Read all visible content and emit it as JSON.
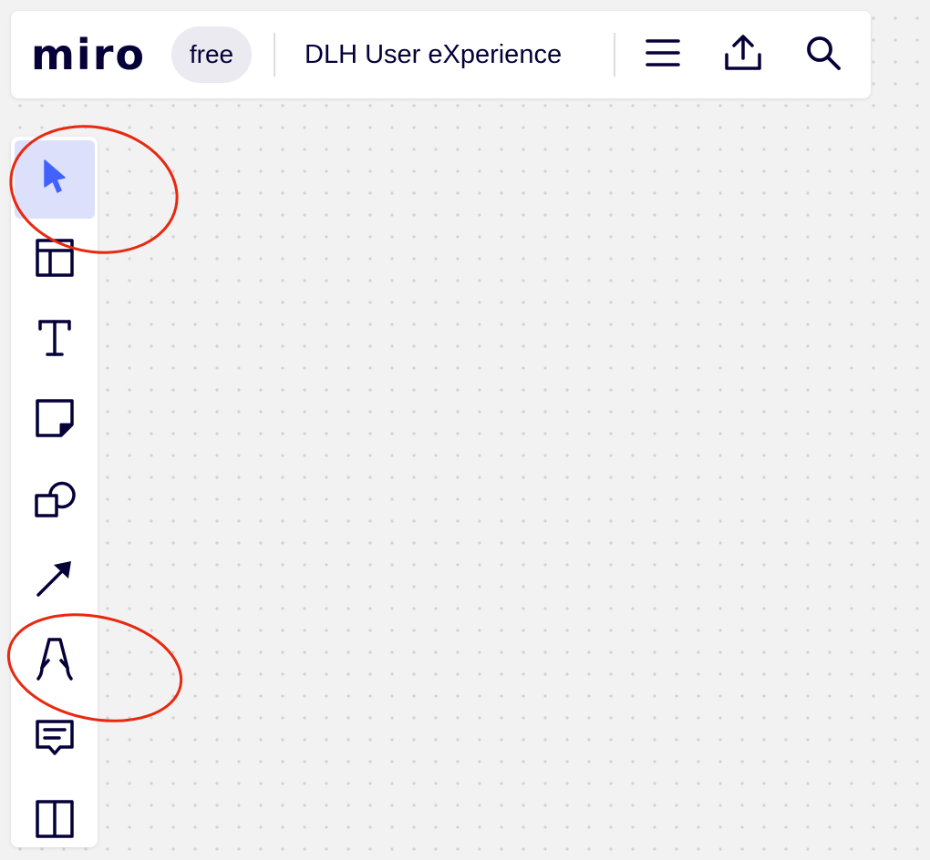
{
  "header": {
    "logo": "miro",
    "plan_badge": "free",
    "board_title": "DLH User eXperience",
    "actions": [
      {
        "name": "menu",
        "icon": "hamburger-menu-icon"
      },
      {
        "name": "share",
        "icon": "upload-icon"
      },
      {
        "name": "search",
        "icon": "search-icon"
      }
    ]
  },
  "toolbar": {
    "selected_tool": "select",
    "tools": [
      {
        "name": "select",
        "icon": "cursor-arrow-icon"
      },
      {
        "name": "frame",
        "icon": "frame-layout-icon"
      },
      {
        "name": "text",
        "icon": "text-t-icon"
      },
      {
        "name": "sticky-note",
        "icon": "sticky-note-icon"
      },
      {
        "name": "shapes",
        "icon": "shapes-icon"
      },
      {
        "name": "connection-line",
        "icon": "arrow-line-icon"
      },
      {
        "name": "pen",
        "icon": "pen-nib-icon"
      },
      {
        "name": "comment",
        "icon": "comment-icon"
      },
      {
        "name": "more",
        "icon": "layout-columns-icon"
      }
    ]
  },
  "annotations": [
    {
      "shape": "ellipse",
      "color": "#e8280f",
      "around": "select"
    },
    {
      "shape": "ellipse",
      "color": "#e8280f",
      "around": "pen"
    }
  ],
  "colors": {
    "ink": "#050038",
    "accent": "#4262ff",
    "selected_bg": "#dde0fb",
    "badge_bg": "#eaeaf0",
    "canvas_bg": "#f2f2f2",
    "annotation": "#e8280f"
  }
}
